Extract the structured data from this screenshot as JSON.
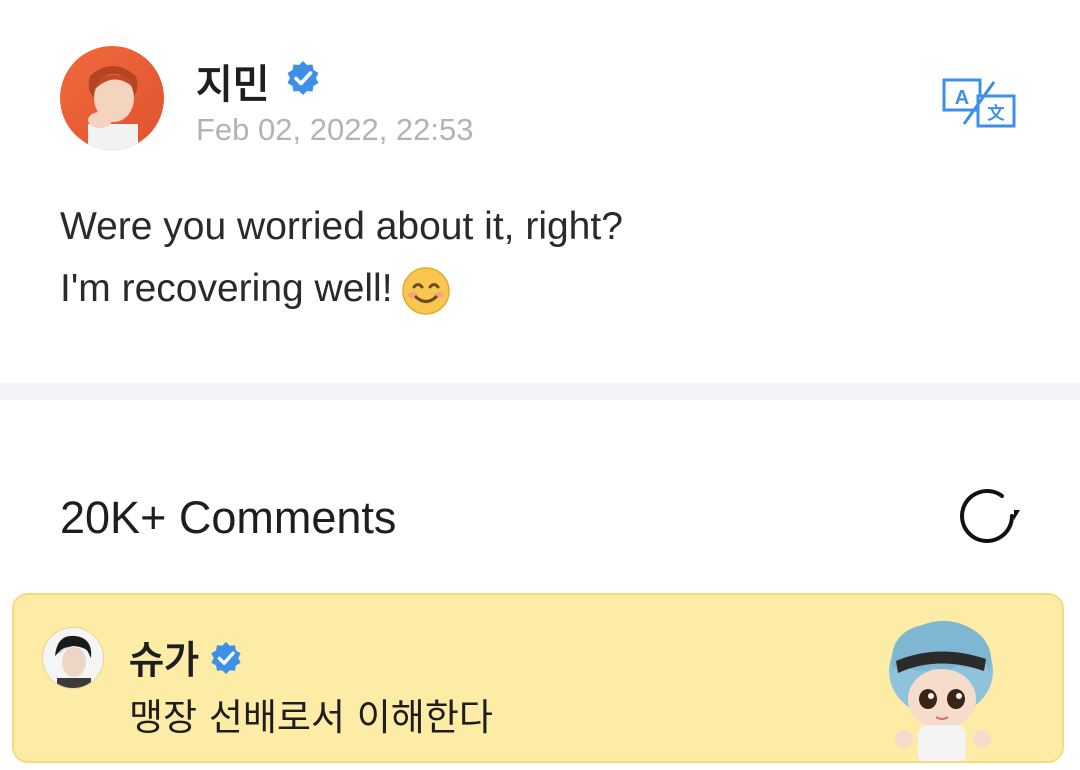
{
  "post": {
    "author": "지민",
    "timestamp": "Feb 02, 2022, 22:53",
    "body_lines": [
      "Were you worried about it, right?",
      "I'm recovering well!"
    ],
    "emoji": "smiling-face-icon",
    "translate_icon": "translate-icon"
  },
  "comments": {
    "title": "20K+ Comments",
    "refresh_icon": "refresh-icon",
    "highlighted": {
      "author": "슈가",
      "text": "맹장 선배로서 이해한다",
      "background": "#fdeca6"
    }
  },
  "colors": {
    "verified": "#3d8fe8",
    "translate": "#3d8fe8",
    "timestamp": "#b3b3b3"
  }
}
